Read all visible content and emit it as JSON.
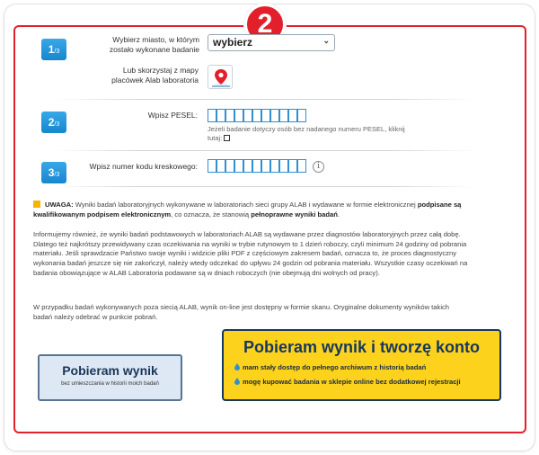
{
  "badge": "2",
  "steps": [
    {
      "num": "1",
      "total": "/3",
      "label": "Wybierz miasto, w którym zostało wykonane badanie"
    },
    {
      "num": "2",
      "total": "/3",
      "label": "Wpisz PESEL:"
    },
    {
      "num": "3",
      "total": "/3",
      "label": "Wpisz numer kodu kreskowego:"
    }
  ],
  "city_select": {
    "value": "wybierz"
  },
  "map": {
    "label": "Lub skorzystaj z mapy placówek Alab laboratoria",
    "icon": "map-pin-icon"
  },
  "pesel": {
    "note": "Jeżeli badanie dotyczy osób bez nadanego numeru PESEL, kliknij tutaj:"
  },
  "barcode": {
    "info_icon": "info-icon"
  },
  "warning": {
    "prefix": "UWAGA:",
    "text1": "Wyniki badań laboratoryjnych wykonywane w laboratoriach sieci grupy ALAB i wydawane w formie elektronicznej",
    "bold1": "podpisane są kwalifikowanym podpisem elektronicznym",
    "text2": ", co oznacza, że stanowią",
    "bold2": "pełnoprawne wyniki badań",
    "text3": "."
  },
  "info_paragraph": "Informujemy również, że wyniki badań podstawowych w laboratoriach ALAB są wydawane przez diagnostów laboratoryjnych przez całą dobę. Dlatego też najkrótszy przewidywany czas oczekiwania na wyniki w trybie rutynowym to 1 dzień roboczy, czyli minimum 24 godziny od pobrania materiału. Jeśli sprawdzacie Państwo swoje wyniki i widzicie pliki PDF z częściowym zakresem badań, oznacza to, że proces diagnostyczny wykonania badań jeszcze się nie zakończył, należy wtedy odczekać do upływu 24 godzin od pobrania materiału. Wszystkie czasy oczekiwań na badania obowiązujące w ALAB Laboratoria podawane są w dniach roboczych (nie obejmują dni wolnych od pracy).",
  "scan_paragraph": "W przypadku badań wykonywanych poza siecią ALAB, wynik on-line jest dostępny w formie skanu. Oryginalne dokumenty wyników takich badań należy odebrać w punkcie pobrań.",
  "btn_plain": {
    "title": "Pobieram wynik",
    "sub": "bez umieszczania w historii moich badań"
  },
  "btn_account": {
    "title": "Pobieram wynik i tworzę konto",
    "items": [
      "mam stały dostęp do pełnego archiwum z historią badań",
      "mogę kupować badania w sklepie online bez dodatkowej rejestracji"
    ]
  },
  "colors": {
    "accent_red": "#e2202c",
    "step_blue": "#1687cf",
    "cta_yellow": "#fcd21c",
    "navy": "#17375e"
  }
}
